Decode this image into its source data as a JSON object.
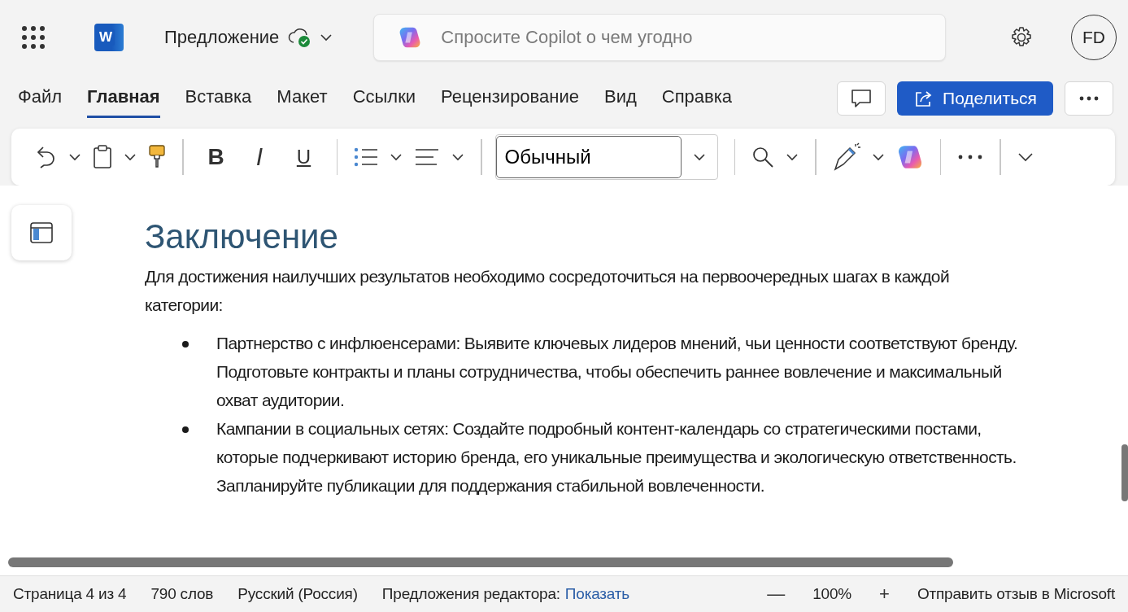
{
  "header": {
    "logo_letter": "W",
    "document_title": "Предложение",
    "search": {
      "placeholder": "Спросите Copilot о чем угодно"
    },
    "avatar": "FD"
  },
  "tabs": [
    {
      "label": "Файл",
      "selected": false
    },
    {
      "label": "Главная",
      "selected": true
    },
    {
      "label": "Вставка",
      "selected": false
    },
    {
      "label": "Макет",
      "selected": false
    },
    {
      "label": "Ссылки",
      "selected": false
    },
    {
      "label": "Рецензирование",
      "selected": false
    },
    {
      "label": "Вид",
      "selected": false
    },
    {
      "label": "Справка",
      "selected": false
    }
  ],
  "share_button": "Поделиться",
  "toolbar": {
    "format_buttons": [
      {
        "label": "B",
        "kind": "bold"
      },
      {
        "label": "I",
        "kind": "italic"
      },
      {
        "label": "U",
        "kind": "underline"
      }
    ],
    "style_field": "Обычный"
  },
  "document": {
    "heading": "Заключение",
    "intro": "Для достижения наилучших результатов необходимо сосредоточиться на первоочередных шагах в каждой категории:",
    "bullets": [
      "Партнерство с инфлюенсерами: Выявите ключевых лидеров мнений, чьи ценности соответствуют бренду. Подготовьте контракты и планы сотрудничества, чтобы обеспечить раннее вовлечение и максимальный охват аудитории.",
      "Кампании в социальных сетях: Создайте подробный контент-календарь со стратегическими постами, которые подчеркивают историю бренда, его уникальные преимущества и экологическую ответственность. Запланируйте публикации для поддержания стабильной вовлеченности."
    ]
  },
  "status_bar": {
    "page": "Страница 4 из 4",
    "words": "790 слов",
    "language": "Русский (Россия)",
    "editor_label": "Предложения редактора:",
    "editor_link": "Показать",
    "zoom_out": "—",
    "zoom": "100%",
    "zoom_in": "+",
    "feedback": "Отправить отзыв в Microsoft"
  }
}
